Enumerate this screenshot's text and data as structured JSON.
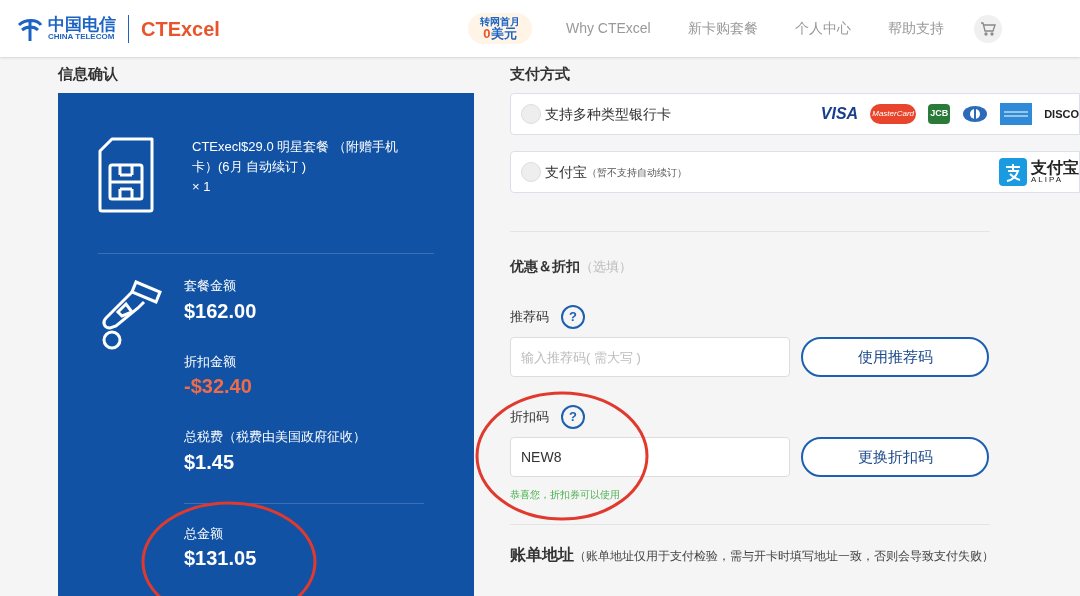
{
  "header": {
    "brand_cn": "中国电信",
    "brand_en": "CHINA TELECOM",
    "product": "CTExcel",
    "promo": {
      "line1": "转网首月",
      "amount": "0",
      "unit": "美元"
    },
    "nav": [
      {
        "label": "Why CTExcel",
        "selected": false
      },
      {
        "label": "新卡购套餐",
        "selected": false
      },
      {
        "label": "个人中心",
        "selected": false
      },
      {
        "label": "帮助支持",
        "selected": false
      }
    ]
  },
  "order": {
    "heading": "信息确认",
    "product": "CTExecl$29.0 明星套餐 （附赠手机卡）(6月 自动续订 )",
    "quantity": "× 1",
    "amounts": [
      {
        "label": "套餐金额",
        "value": "$162.00",
        "kind": "normal"
      },
      {
        "label": "折扣金额",
        "value": "-$32.40",
        "kind": "discount"
      },
      {
        "label": "总税费（税费由美国政府征收）",
        "value": "$1.45",
        "kind": "normal"
      }
    ],
    "total": {
      "label": "总金额",
      "value": "$131.05"
    }
  },
  "payment": {
    "heading": "支付方式",
    "methods": [
      {
        "kind": "card",
        "label": "支持多种类型银行卡",
        "selected": false,
        "logos": [
          "VISA",
          "MasterCard",
          "JCB",
          "DISCO"
        ]
      },
      {
        "kind": "alipay",
        "label": "支付宝",
        "note": "（暂不支持自动续订）",
        "selected": false,
        "logos": [
          "支付宝",
          "ALIPA"
        ]
      }
    ]
  },
  "discounts": {
    "title": "优惠＆折扣",
    "optional": "（选填）",
    "codes": [
      {
        "label": "推荐码",
        "help": "?",
        "placeholder": "输入推荐码( 需大写 )",
        "button": "使用推荐码"
      },
      {
        "label": "折扣码",
        "help": "?",
        "value": "NEW8",
        "button": "更换折扣码",
        "message": "恭喜您，折扣券可以使用"
      }
    ]
  },
  "billing": {
    "title": "账单地址",
    "note": "（账单地址仅用于支付检验，需与开卡时填写地址一致，否则会导致支付失败）"
  }
}
